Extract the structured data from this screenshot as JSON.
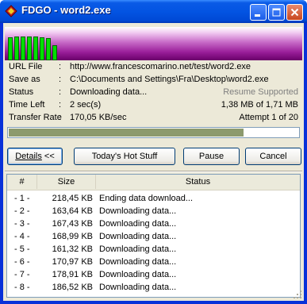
{
  "window": {
    "title": "FDGO - word2.exe"
  },
  "titlebar": {
    "minimize_icon": "minimize-icon",
    "maximize_icon": "maximize-icon",
    "close_icon": "close-icon"
  },
  "meter": {
    "levels": [
      0.88,
      0.92,
      0.92,
      0.92,
      0.92,
      0.88,
      0.86,
      0.58
    ]
  },
  "info": {
    "url_label": "URL File",
    "url_value": "http://www.francescomarino.net/test/word2.exe",
    "saveas_label": "Save as",
    "saveas_value": "C:\\Documents and Settings\\Fra\\Desktop\\word2.exe",
    "status_label": "Status",
    "status_value": "Downloading data...",
    "resume_text": "Resume Supported",
    "timeleft_label": "Time Left",
    "timeleft_value": "2 sec(s)",
    "size_progress": "1,38 MB of 1,71 MB",
    "rate_label": "Transfer Rate",
    "rate_value": "170,05 KB/sec",
    "attempt_text": "Attempt 1 of 20",
    "colon": ":"
  },
  "progress": {
    "fraction": 0.81
  },
  "buttons": {
    "details_prefix": "Details",
    "details_suffix": " <<",
    "hot_stuff": "Today's Hot Stuff",
    "pause": "Pause",
    "cancel": "Cancel"
  },
  "list": {
    "columns": [
      "#",
      "Size",
      "Status"
    ],
    "rows": [
      {
        "num": "- 1 -",
        "size": "218,45 KB",
        "status": "Ending data download..."
      },
      {
        "num": "- 2 -",
        "size": "163,64 KB",
        "status": "Downloading data..."
      },
      {
        "num": "- 3 -",
        "size": "167,43 KB",
        "status": "Downloading data..."
      },
      {
        "num": "- 4 -",
        "size": "168,99 KB",
        "status": "Downloading data..."
      },
      {
        "num": "- 5 -",
        "size": "161,32 KB",
        "status": "Downloading data..."
      },
      {
        "num": "- 6 -",
        "size": "170,97 KB",
        "status": "Downloading data..."
      },
      {
        "num": "- 7 -",
        "size": "178,91 KB",
        "status": "Downloading data..."
      },
      {
        "num": "- 8 -",
        "size": "186,52 KB",
        "status": "Downloading data..."
      }
    ]
  }
}
